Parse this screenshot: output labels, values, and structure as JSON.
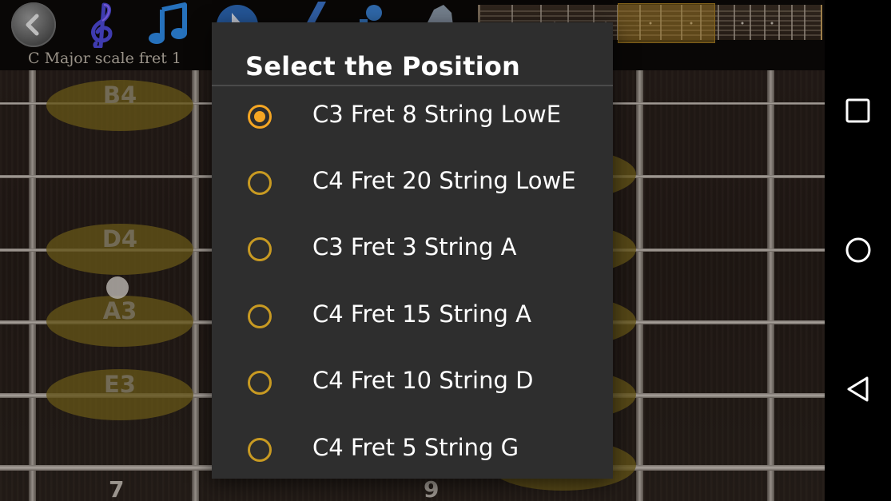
{
  "toolbar": {
    "song_title": "C Major scale fret 1",
    "icons": [
      "back-icon",
      "treble-clef-icon",
      "music-note-icon",
      "play-icon",
      "pencil-icon",
      "metronome-icon",
      "shape-icon"
    ]
  },
  "fretboard": {
    "notes": [
      {
        "label": "B4"
      },
      {
        "label": "D4"
      },
      {
        "label": "A3"
      },
      {
        "label": "E3"
      }
    ],
    "fret_numbers": [
      "7",
      "9"
    ]
  },
  "dialog": {
    "title": "Select the Position",
    "options": [
      {
        "label": "C3 Fret 8 String LowE",
        "checked": true
      },
      {
        "label": "C4 Fret 20 String LowE",
        "checked": false
      },
      {
        "label": "C3 Fret 3 String A",
        "checked": false
      },
      {
        "label": "C4 Fret 15 String A",
        "checked": false
      },
      {
        "label": "C4 Fret 10 String D",
        "checked": false
      },
      {
        "label": "C4 Fret 5 String G",
        "checked": false
      }
    ]
  },
  "navbar": {
    "buttons": [
      "recents-button",
      "home-button",
      "back-button"
    ]
  },
  "colors": {
    "accent": "#f5a623",
    "dialog_bg": "#2e2e2e",
    "note_oval": "#7a661e"
  }
}
